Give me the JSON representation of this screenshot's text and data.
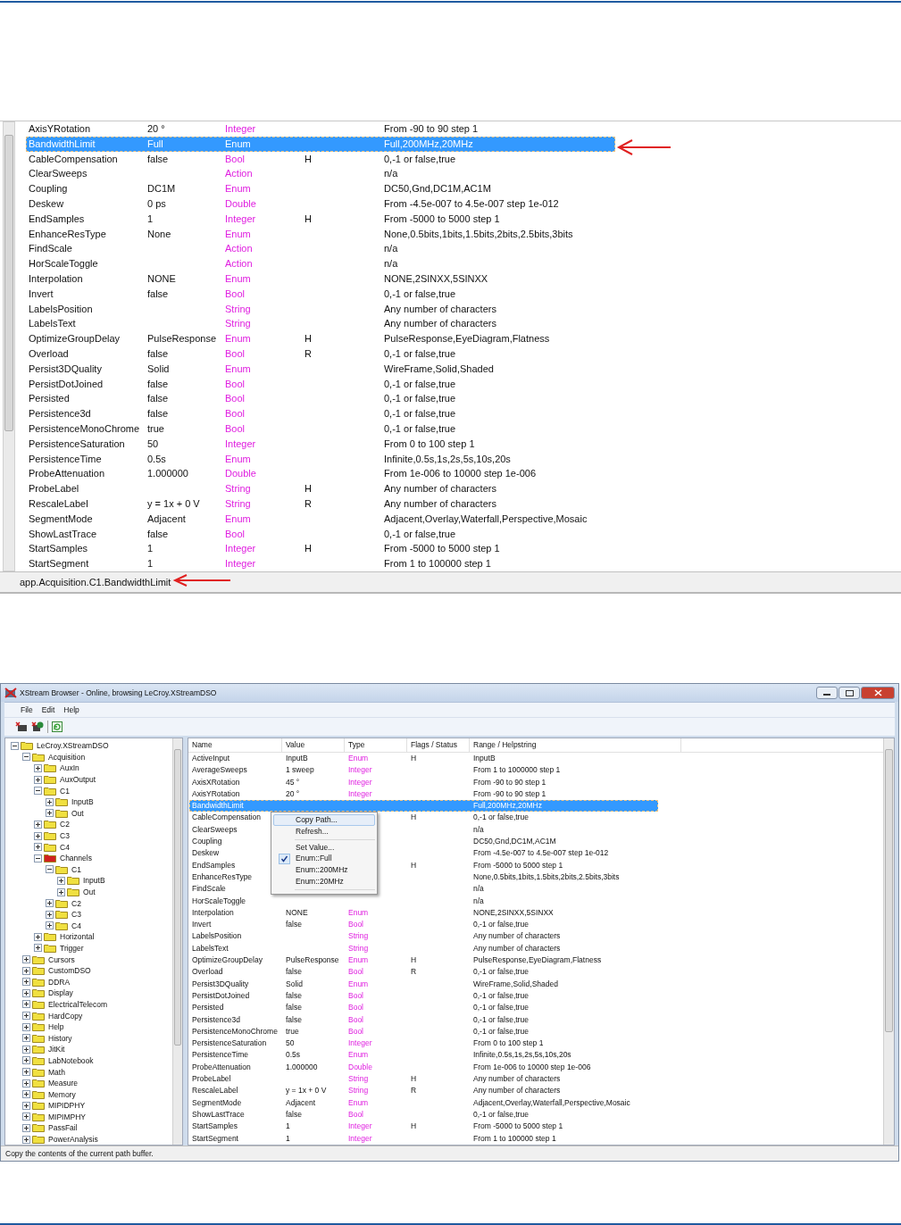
{
  "top_panel": {
    "rows": [
      {
        "name": "AxisYRotation",
        "value": "20 °",
        "type": "Integer",
        "range": "From -90 to 90 step 1",
        "selected": false
      },
      {
        "name": "BandwidthLimit",
        "value": "Full",
        "type": "Enum",
        "range": "Full,200MHz,20MHz",
        "selected": true
      },
      {
        "name": "CableCompensation",
        "value": "false",
        "type": "Bool",
        "flags": "H",
        "range": "0,-1 or false,true",
        "selected": false
      },
      {
        "name": "ClearSweeps",
        "type": "Action",
        "range": "n/a",
        "selected": false
      },
      {
        "name": "Coupling",
        "value": "DC1M",
        "type": "Enum",
        "range": "DC50,Gnd,DC1M,AC1M",
        "selected": false
      },
      {
        "name": "Deskew",
        "value": "0 ps",
        "type": "Double",
        "range": "From -4.5e-007 to 4.5e-007 step 1e-012",
        "selected": false
      },
      {
        "name": "EndSamples",
        "value": "1",
        "type": "Integer",
        "flags": "H",
        "range": "From -5000 to 5000 step 1",
        "selected": false
      },
      {
        "name": "EnhanceResType",
        "value": "None",
        "type": "Enum",
        "range": "None,0.5bits,1bits,1.5bits,2bits,2.5bits,3bits",
        "selected": false
      },
      {
        "name": "FindScale",
        "type": "Action",
        "range": "n/a",
        "selected": false
      },
      {
        "name": "HorScaleToggle",
        "type": "Action",
        "range": "n/a",
        "selected": false
      },
      {
        "name": "Interpolation",
        "value": "NONE",
        "type": "Enum",
        "range": "NONE,2SINXX,5SINXX",
        "selected": false
      },
      {
        "name": "Invert",
        "value": "false",
        "type": "Bool",
        "range": "0,-1 or false,true",
        "selected": false
      },
      {
        "name": "LabelsPosition",
        "type": "String",
        "range": "Any number of characters",
        "selected": false
      },
      {
        "name": "LabelsText",
        "type": "String",
        "range": "Any number of characters",
        "selected": false
      },
      {
        "name": "OptimizeGroupDelay",
        "value": "PulseResponse",
        "type": "Enum",
        "flags": "H",
        "range": "PulseResponse,EyeDiagram,Flatness",
        "selected": false
      },
      {
        "name": "Overload",
        "value": "false",
        "type": "Bool",
        "flags": "R",
        "range": "0,-1 or false,true",
        "selected": false
      },
      {
        "name": "Persist3DQuality",
        "value": "Solid",
        "type": "Enum",
        "range": "WireFrame,Solid,Shaded",
        "selected": false
      },
      {
        "name": "PersistDotJoined",
        "value": "false",
        "type": "Bool",
        "range": "0,-1 or false,true",
        "selected": false
      },
      {
        "name": "Persisted",
        "value": "false",
        "type": "Bool",
        "range": "0,-1 or false,true",
        "selected": false
      },
      {
        "name": "Persistence3d",
        "value": "false",
        "type": "Bool",
        "range": "0,-1 or false,true",
        "selected": false
      },
      {
        "name": "PersistenceMonoChrome",
        "value": "true",
        "type": "Bool",
        "range": "0,-1 or false,true",
        "selected": false
      },
      {
        "name": "PersistenceSaturation",
        "value": "50",
        "type": "Integer",
        "range": "From 0 to 100 step 1",
        "selected": false
      },
      {
        "name": "PersistenceTime",
        "value": "0.5s",
        "type": "Enum",
        "range": "Infinite,0.5s,1s,2s,5s,10s,20s",
        "selected": false
      },
      {
        "name": "ProbeAttenuation",
        "value": "1.000000",
        "type": "Double",
        "range": "From 1e-006 to 10000 step 1e-006",
        "selected": false
      },
      {
        "name": "ProbeLabel",
        "type": "String",
        "flags": "H",
        "range": "Any number of characters",
        "selected": false
      },
      {
        "name": "RescaleLabel",
        "value": "y = 1x + 0 V",
        "type": "String",
        "flags": "R",
        "range": "Any number of characters",
        "selected": false
      },
      {
        "name": "SegmentMode",
        "value": "Adjacent",
        "type": "Enum",
        "range": "Adjacent,Overlay,Waterfall,Perspective,Mosaic",
        "selected": false
      },
      {
        "name": "ShowLastTrace",
        "value": "false",
        "type": "Bool",
        "range": "0,-1 or false,true",
        "selected": false
      },
      {
        "name": "StartSamples",
        "value": "1",
        "type": "Integer",
        "flags": "H",
        "range": "From -5000 to 5000 step 1",
        "selected": false
      },
      {
        "name": "StartSegment",
        "value": "1",
        "type": "Integer",
        "range": "From 1 to 100000 step 1",
        "selected": false
      }
    ],
    "status_path": "app.Acquisition.C1.BandwidthLimit"
  },
  "window": {
    "title": "XStream Browser - Online, browsing LeCroy.XStreamDSO",
    "menu": [
      "File",
      "Edit",
      "Help"
    ],
    "tree": [
      {
        "label": "LeCroy.XStreamDSO",
        "expanded": true,
        "children": [
          {
            "label": "Acquisition",
            "expanded": true,
            "children": [
              {
                "label": "AuxIn",
                "expanded": false
              },
              {
                "label": "AuxOutput",
                "expanded": false
              },
              {
                "label": "C1",
                "expanded": true,
                "children": [
                  {
                    "label": "InputB",
                    "expanded": false
                  },
                  {
                    "label": "Out",
                    "expanded": false
                  }
                ]
              },
              {
                "label": "C2",
                "expanded": false
              },
              {
                "label": "C3",
                "expanded": false
              },
              {
                "label": "C4",
                "expanded": false
              },
              {
                "label": "Channels",
                "expanded": true,
                "color": "#d02020",
                "children": [
                  {
                    "label": "C1",
                    "expanded": true,
                    "children": [
                      {
                        "label": "InputB",
                        "expanded": false
                      },
                      {
                        "label": "Out",
                        "expanded": false
                      }
                    ]
                  },
                  {
                    "label": "C2",
                    "expanded": false
                  },
                  {
                    "label": "C3",
                    "expanded": false
                  },
                  {
                    "label": "C4",
                    "expanded": false
                  }
                ]
              },
              {
                "label": "Horizontal",
                "expanded": false
              },
              {
                "label": "Trigger",
                "expanded": false
              }
            ]
          },
          {
            "label": "Cursors",
            "expanded": false
          },
          {
            "label": "CustomDSO",
            "expanded": false
          },
          {
            "label": "DDRA",
            "expanded": false
          },
          {
            "label": "Display",
            "expanded": false
          },
          {
            "label": "ElectricalTelecom",
            "expanded": false
          },
          {
            "label": "HardCopy",
            "expanded": false
          },
          {
            "label": "Help",
            "expanded": false
          },
          {
            "label": "History",
            "expanded": false
          },
          {
            "label": "JitKit",
            "expanded": false
          },
          {
            "label": "LabNotebook",
            "expanded": false
          },
          {
            "label": "Math",
            "expanded": false
          },
          {
            "label": "Measure",
            "expanded": false
          },
          {
            "label": "Memory",
            "expanded": false
          },
          {
            "label": "MIPIDPHY",
            "expanded": false
          },
          {
            "label": "MIPIMPHY",
            "expanded": false
          },
          {
            "label": "PassFail",
            "expanded": false
          },
          {
            "label": "PowerAnalysis",
            "expanded": false
          }
        ]
      }
    ],
    "table": {
      "columns": [
        "Name",
        "Value",
        "Type",
        "Flags / Status",
        "Range / Helpstring"
      ],
      "rows": [
        {
          "name": "ActiveInput",
          "value": "InputB",
          "type": "Enum",
          "flags": "H",
          "range": "InputB",
          "selected": false
        },
        {
          "name": "AverageSweeps",
          "value": "1 sweep",
          "type": "Integer",
          "range": "From 1 to 1000000 step 1",
          "selected": false
        },
        {
          "name": "AxisXRotation",
          "value": "45 °",
          "type": "Integer",
          "range": "From -90 to 90 step 1",
          "selected": false
        },
        {
          "name": "AxisYRotation",
          "value": "20 °",
          "type": "Integer",
          "range": "From -90 to 90 step 1",
          "selected": false
        },
        {
          "name": "BandwidthLimit",
          "range": "Full,200MHz,20MHz",
          "selected": true
        },
        {
          "name": "CableCompensation",
          "flags": "H",
          "range": "0,-1 or false,true",
          "selected": false
        },
        {
          "name": "ClearSweeps",
          "range": "n/a",
          "selected": false
        },
        {
          "name": "Coupling",
          "range": "DC50,Gnd,DC1M,AC1M",
          "selected": false
        },
        {
          "name": "Deskew",
          "range": "From -4.5e-007 to 4.5e-007 step 1e-012",
          "selected": false
        },
        {
          "name": "EndSamples",
          "flags": "H",
          "range": "From -5000 to 5000 step 1",
          "selected": false
        },
        {
          "name": "EnhanceResType",
          "range": "None,0.5bits,1bits,1.5bits,2bits,2.5bits,3bits",
          "selected": false
        },
        {
          "name": "FindScale",
          "range": "n/a",
          "selected": false
        },
        {
          "name": "HorScaleToggle",
          "range": "n/a",
          "selected": false
        },
        {
          "name": "Interpolation",
          "value": "NONE",
          "type": "Enum",
          "range": "NONE,2SINXX,5SINXX",
          "selected": false
        },
        {
          "name": "Invert",
          "value": "false",
          "type": "Bool",
          "range": "0,-1 or false,true",
          "selected": false
        },
        {
          "name": "LabelsPosition",
          "type": "String",
          "range": "Any number of characters",
          "selected": false
        },
        {
          "name": "LabelsText",
          "type": "String",
          "range": "Any number of characters",
          "selected": false
        },
        {
          "name": "OptimizeGroupDelay",
          "value": "PulseResponse",
          "type": "Enum",
          "flags": "H",
          "range": "PulseResponse,EyeDiagram,Flatness",
          "selected": false
        },
        {
          "name": "Overload",
          "value": "false",
          "type": "Bool",
          "flags": "R",
          "range": "0,-1 or false,true",
          "selected": false
        },
        {
          "name": "Persist3DQuality",
          "value": "Solid",
          "type": "Enum",
          "range": "WireFrame,Solid,Shaded",
          "selected": false
        },
        {
          "name": "PersistDotJoined",
          "value": "false",
          "type": "Bool",
          "range": "0,-1 or false,true",
          "selected": false
        },
        {
          "name": "Persisted",
          "value": "false",
          "type": "Bool",
          "range": "0,-1 or false,true",
          "selected": false
        },
        {
          "name": "Persistence3d",
          "value": "false",
          "type": "Bool",
          "range": "0,-1 or false,true",
          "selected": false
        },
        {
          "name": "PersistenceMonoChrome",
          "value": "true",
          "type": "Bool",
          "range": "0,-1 or false,true",
          "selected": false
        },
        {
          "name": "PersistenceSaturation",
          "value": "50",
          "type": "Integer",
          "range": "From 0 to 100 step 1",
          "selected": false
        },
        {
          "name": "PersistenceTime",
          "value": "0.5s",
          "type": "Enum",
          "range": "Infinite,0.5s,1s,2s,5s,10s,20s",
          "selected": false
        },
        {
          "name": "ProbeAttenuation",
          "value": "1.000000",
          "type": "Double",
          "range": "From 1e-006 to 10000 step 1e-006",
          "selected": false
        },
        {
          "name": "ProbeLabel",
          "type": "String",
          "flags": "H",
          "range": "Any number of characters",
          "selected": false
        },
        {
          "name": "RescaleLabel",
          "value": "y = 1x + 0 V",
          "type": "String",
          "flags": "R",
          "range": "Any number of characters",
          "selected": false
        },
        {
          "name": "SegmentMode",
          "value": "Adjacent",
          "type": "Enum",
          "range": "Adjacent,Overlay,Waterfall,Perspective,Mosaic",
          "selected": false
        },
        {
          "name": "ShowLastTrace",
          "value": "false",
          "type": "Bool",
          "range": "0,-1 or false,true",
          "selected": false
        },
        {
          "name": "StartSamples",
          "value": "1",
          "type": "Integer",
          "flags": "H",
          "range": "From -5000 to 5000 step 1",
          "selected": false
        },
        {
          "name": "StartSegment",
          "value": "1",
          "type": "Integer",
          "range": "From 1 to 100000 step 1",
          "selected": false
        }
      ]
    },
    "context_menu": [
      {
        "kind": "item",
        "label": "Copy Path...",
        "checked": false,
        "selected": true
      },
      {
        "kind": "item",
        "label": "Refresh...",
        "checked": false,
        "selected": false
      },
      {
        "kind": "separator"
      },
      {
        "kind": "item",
        "label": "Set Value...",
        "checked": false,
        "selected": false
      },
      {
        "kind": "item",
        "label": "Enum::Full",
        "checked": true,
        "selected": false
      },
      {
        "kind": "item",
        "label": "Enum::200MHz",
        "checked": false,
        "selected": false
      },
      {
        "kind": "item",
        "label": "Enum::20MHz",
        "checked": false,
        "selected": false
      },
      {
        "kind": "separator"
      }
    ],
    "status_bar": "Copy the contents of the current path buffer."
  }
}
